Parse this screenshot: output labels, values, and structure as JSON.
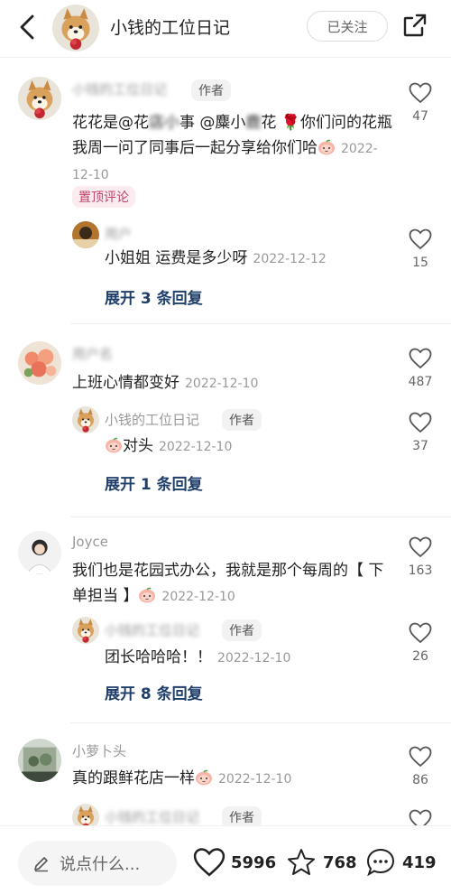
{
  "header": {
    "title": "小钱的工位日记",
    "follow_label": "已关注"
  },
  "comments": [
    {
      "name": "小钱的工位日记",
      "author_tag": "作者",
      "text_part1": "花花是@花",
      "text_blur1": "店小",
      "text_part2": "事 @麋小",
      "text_blur2": "鹿",
      "text_part3": "花 🌹你们问的花瓶我周一问了同事后一起分享给你们哈",
      "date": "2022-12-10",
      "pinned": "置顶评论",
      "likes": "47",
      "reply": {
        "name": "用户",
        "text": "小姐姐 运费是多少呀",
        "date": "2022-12-12",
        "likes": "15"
      },
      "expand": "展开 3 条回复"
    },
    {
      "name": "用户名",
      "text": "上班心情都变好",
      "date": "2022-12-10",
      "likes": "487",
      "reply": {
        "name": "小钱的工位日记",
        "author_tag": "作者",
        "text": "对头",
        "date": "2022-12-10",
        "likes": "37"
      },
      "expand": "展开 1 条回复"
    },
    {
      "name": "Joyce",
      "text": "我们也是花园式办公，我就是那个每周的【 下单担当 】",
      "date": "2022-12-10",
      "likes": "163",
      "reply": {
        "name": "小钱的工位日记",
        "author_tag": "作者",
        "text": "团长哈哈哈！！",
        "date": "2022-12-10",
        "likes": "26"
      },
      "expand": "展开 8 条回复"
    },
    {
      "name": "小萝卜头",
      "text": "真的跟鲜花店一样",
      "date": "2022-12-10",
      "likes": "86",
      "reply": {
        "name": "小钱的工位日记",
        "author_tag": "作者"
      }
    }
  ],
  "bottom": {
    "placeholder": "说点什么...",
    "likes": "5996",
    "stars": "768",
    "comments": "419"
  },
  "colors": {
    "pinned": "#c0456b",
    "expand": "#1f3f6b",
    "muted": "#999999"
  }
}
